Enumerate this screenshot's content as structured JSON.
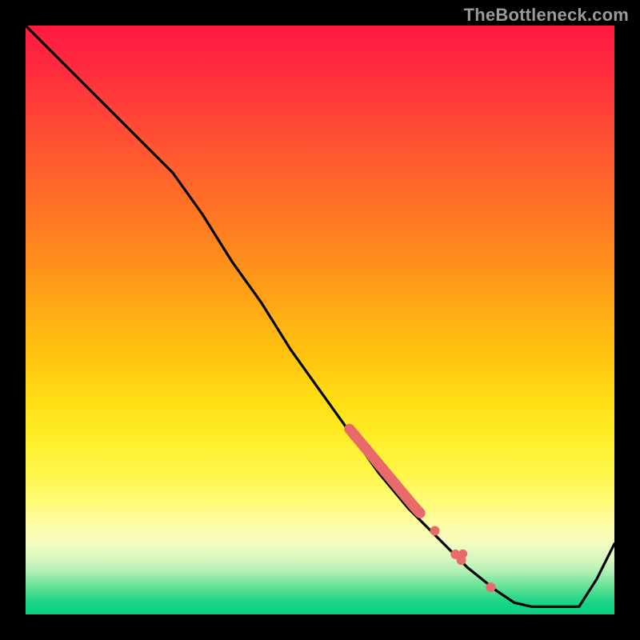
{
  "watermark": "TheBottleneck.com",
  "colors": {
    "background": "#000000",
    "curve": "#000000",
    "marker": "#e96a6a",
    "gradient_top": "#ff1a40",
    "gradient_bottom": "#04d282"
  },
  "chart_data": {
    "type": "line",
    "title": "",
    "xlabel": "",
    "ylabel": "",
    "xlim": [
      0,
      100
    ],
    "ylim": [
      0,
      100
    ],
    "grid": false,
    "legend": false,
    "note": "Axes are implicit (no tick labels in image); values are approximate percentages of the plot area, origin at bottom-left.",
    "series": [
      {
        "name": "bottleneck-curve",
        "x": [
          0,
          5,
          10,
          15,
          20,
          25,
          30,
          35,
          40,
          45,
          50,
          55,
          60,
          65,
          70,
          75,
          80,
          83,
          86,
          90,
          94,
          97,
          100
        ],
        "y": [
          100,
          95,
          90,
          85,
          80,
          75,
          68,
          60,
          53,
          45,
          38,
          31,
          24,
          18,
          13,
          8,
          4,
          2,
          1.3,
          1.3,
          1.3,
          6,
          12
        ]
      }
    ],
    "markers": [
      {
        "name": "highlighted-range",
        "shape": "circle",
        "color": "#e96a6a",
        "points_xy": [
          [
            55,
            31.5
          ],
          [
            56,
            30.3
          ],
          [
            57,
            29.1
          ],
          [
            58,
            27.9
          ],
          [
            59,
            26.7
          ],
          [
            60,
            25.5
          ],
          [
            61,
            24.3
          ],
          [
            62,
            23.1
          ],
          [
            63,
            21.9
          ],
          [
            64,
            20.7
          ],
          [
            65,
            19.5
          ],
          [
            66,
            18.3
          ],
          [
            67,
            17.2
          ],
          [
            69.5,
            14.2
          ],
          [
            73,
            10.2
          ],
          [
            74,
            9.2
          ],
          [
            79,
            4.6
          ]
        ]
      }
    ]
  }
}
